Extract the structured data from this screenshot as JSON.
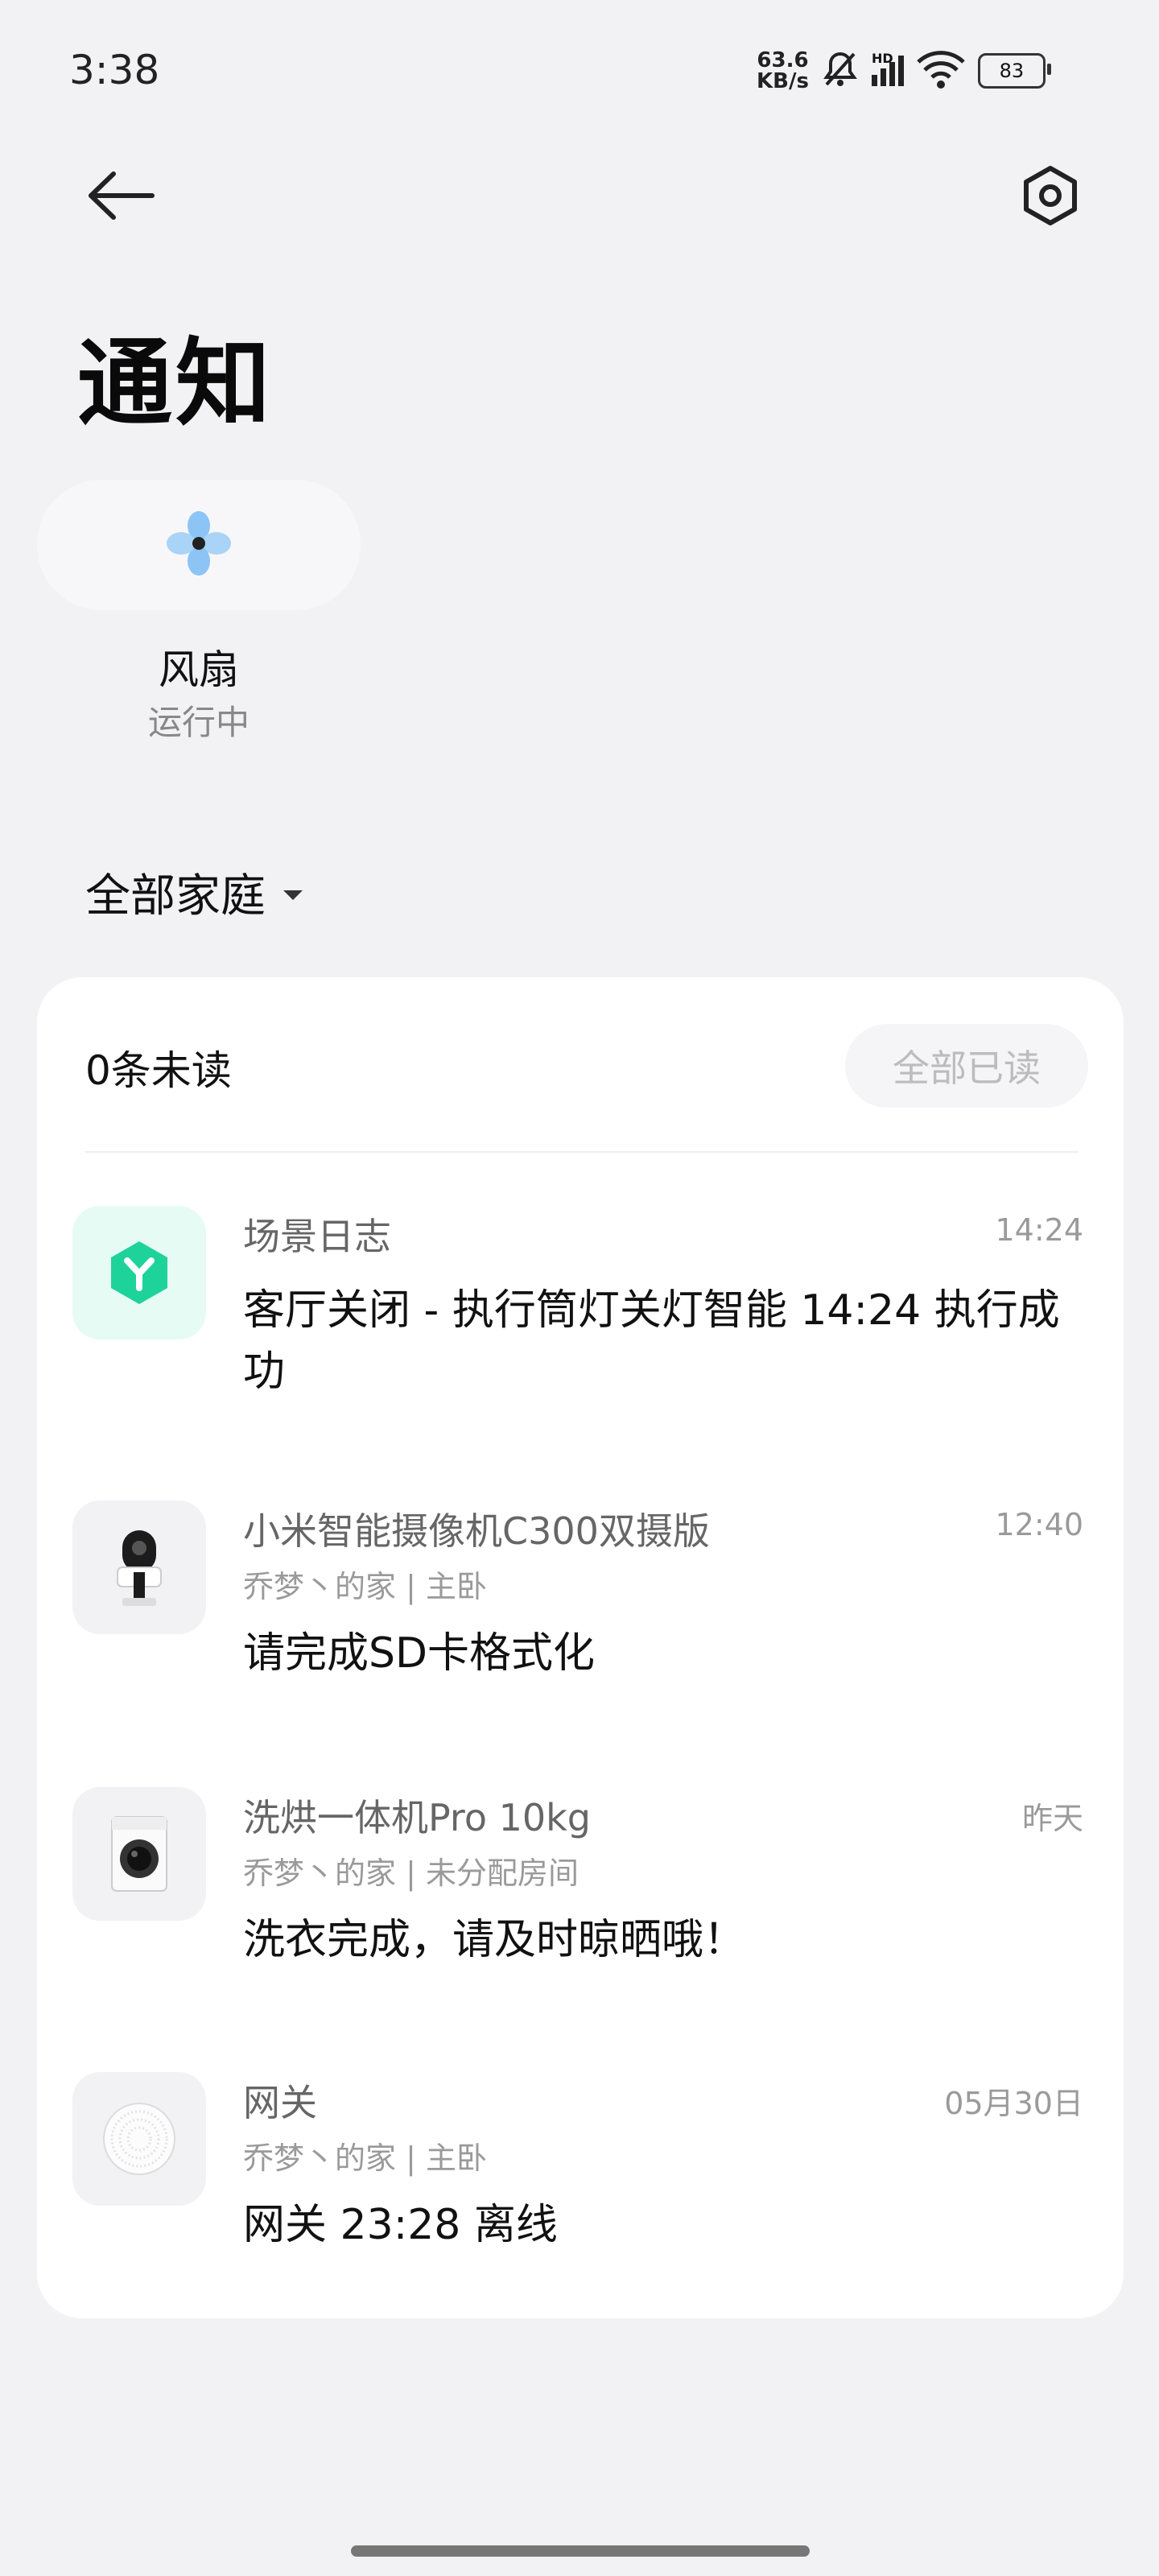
{
  "status_bar": {
    "time": "3:38",
    "net_speed_value": "63.6",
    "net_speed_unit": "KB/s",
    "signal_label": "HD",
    "battery": "83",
    "icons": [
      "mute-bell-icon",
      "signal-icon",
      "wifi-icon",
      "battery-icon"
    ]
  },
  "header": {
    "title": "通知"
  },
  "device": {
    "name": "风扇",
    "status": "运行中",
    "icon": "fan-icon"
  },
  "family_selector": {
    "label": "全部家庭"
  },
  "card": {
    "unread_label": "0条未读",
    "mark_all_read": "全部已读",
    "notifications": [
      {
        "icon": "scene-log-icon",
        "source": "场景日志",
        "time": "14:24",
        "subtitle": "",
        "message": "客厅关闭 - 执行筒灯关灯智能 14:24 执行成功"
      },
      {
        "icon": "camera-icon",
        "source": "小米智能摄像机C300双摄版",
        "time": "12:40",
        "subtitle": "乔梦丶的家 | 主卧",
        "message": "请完成SD卡格式化"
      },
      {
        "icon": "washer-icon",
        "source": "洗烘一体机Pro 10kg",
        "time": "昨天",
        "subtitle": "乔梦丶的家 | 未分配房间",
        "message": "洗衣完成，请及时晾晒哦！"
      },
      {
        "icon": "gateway-icon",
        "source": "网关",
        "time": "05月30日",
        "subtitle": "乔梦丶的家 | 主卧",
        "message": "网关 23:28 离线"
      }
    ]
  },
  "colors": {
    "background": "#f2f2f4",
    "card": "#ffffff",
    "scene_icon_bg": "#e6fbf3",
    "scene_icon_fg": "#1dd39a",
    "fan_blue": "#8cc4f5"
  }
}
